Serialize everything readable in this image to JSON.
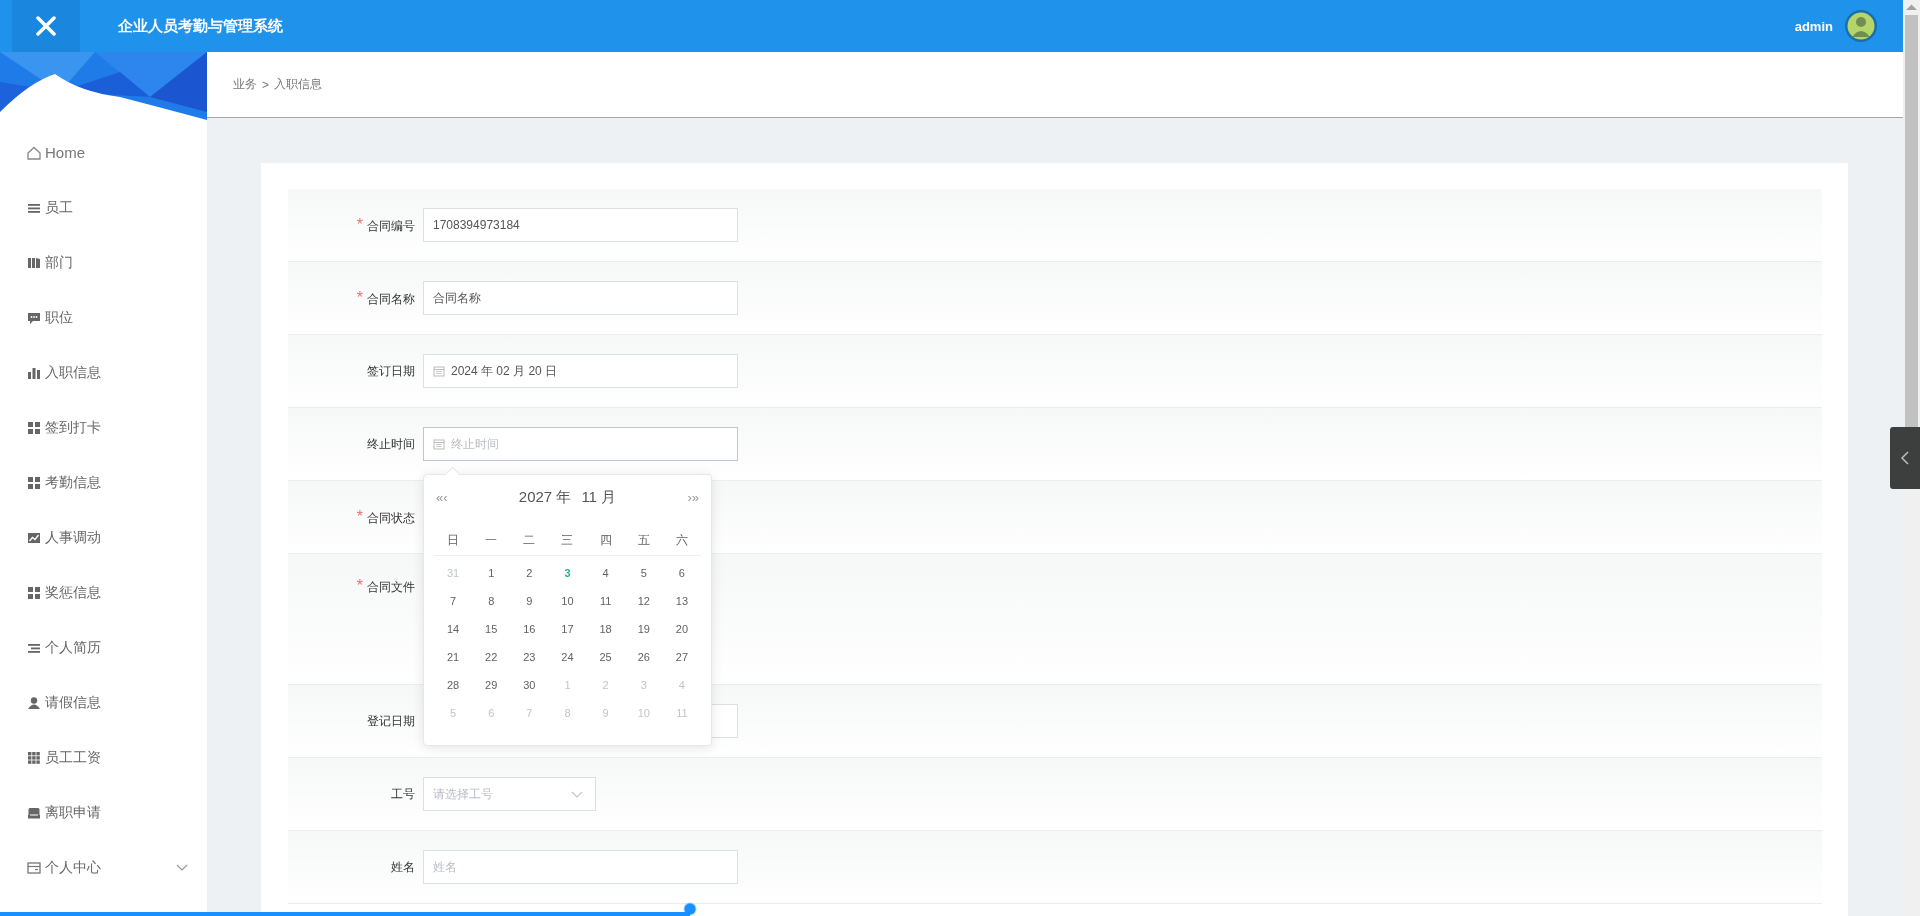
{
  "header": {
    "title": "企业人员考勤与管理系统",
    "user": "admin"
  },
  "sidebar": {
    "items": [
      {
        "label": "Home"
      },
      {
        "label": "员工"
      },
      {
        "label": "部门"
      },
      {
        "label": "职位"
      },
      {
        "label": "入职信息"
      },
      {
        "label": "签到打卡"
      },
      {
        "label": "考勤信息"
      },
      {
        "label": "人事调动"
      },
      {
        "label": "奖惩信息"
      },
      {
        "label": "个人简历"
      },
      {
        "label": "请假信息"
      },
      {
        "label": "员工工资"
      },
      {
        "label": "离职申请"
      }
    ],
    "group": {
      "label": "个人中心",
      "expanded": false
    }
  },
  "breadcrumb": {
    "items": [
      "业务",
      "入职信息"
    ],
    "separator": ">"
  },
  "form": {
    "required_mark": "*",
    "rows": [
      {
        "label": "合同编号",
        "required": true,
        "kind": "text",
        "value": "1708394973184"
      },
      {
        "label": "合同名称",
        "required": true,
        "kind": "text",
        "value": "合同名称"
      },
      {
        "label": "签订日期",
        "required": false,
        "kind": "date",
        "value": "2024 年 02 月 20 日"
      },
      {
        "label": "终止时间",
        "required": false,
        "kind": "date",
        "placeholder": "终止时间",
        "open": true
      },
      {
        "label": "合同状态",
        "required": true,
        "kind": "covered"
      },
      {
        "label": "合同文件",
        "required": true,
        "kind": "file"
      },
      {
        "label": "登记日期",
        "required": false,
        "kind": "text"
      },
      {
        "label": "工号",
        "required": false,
        "kind": "select",
        "placeholder": "请选择工号"
      },
      {
        "label": "姓名",
        "required": false,
        "kind": "text",
        "placeholder": "姓名"
      }
    ]
  },
  "calendar": {
    "prev": "«‹",
    "next": "›»",
    "year": "2027 年",
    "month": "11 月",
    "weekdays": [
      "日",
      "一",
      "二",
      "三",
      "四",
      "五",
      "六"
    ],
    "days": [
      {
        "label": "31",
        "kind": "other"
      },
      {
        "label": "1",
        "kind": "day"
      },
      {
        "label": "2",
        "kind": "day"
      },
      {
        "label": "3",
        "kind": "today"
      },
      {
        "label": "4",
        "kind": "day"
      },
      {
        "label": "5",
        "kind": "day"
      },
      {
        "label": "6",
        "kind": "day"
      },
      {
        "label": "7",
        "kind": "day"
      },
      {
        "label": "8",
        "kind": "day"
      },
      {
        "label": "9",
        "kind": "day"
      },
      {
        "label": "10",
        "kind": "day"
      },
      {
        "label": "11",
        "kind": "day"
      },
      {
        "label": "12",
        "kind": "day"
      },
      {
        "label": "13",
        "kind": "day"
      },
      {
        "label": "14",
        "kind": "day"
      },
      {
        "label": "15",
        "kind": "day"
      },
      {
        "label": "16",
        "kind": "day"
      },
      {
        "label": "17",
        "kind": "day"
      },
      {
        "label": "18",
        "kind": "day"
      },
      {
        "label": "19",
        "kind": "day"
      },
      {
        "label": "20",
        "kind": "day"
      },
      {
        "label": "21",
        "kind": "day"
      },
      {
        "label": "22",
        "kind": "day"
      },
      {
        "label": "23",
        "kind": "day"
      },
      {
        "label": "24",
        "kind": "day"
      },
      {
        "label": "25",
        "kind": "day"
      },
      {
        "label": "26",
        "kind": "day"
      },
      {
        "label": "27",
        "kind": "day"
      },
      {
        "label": "28",
        "kind": "day"
      },
      {
        "label": "29",
        "kind": "day"
      },
      {
        "label": "30",
        "kind": "day"
      },
      {
        "label": "1",
        "kind": "other"
      },
      {
        "label": "2",
        "kind": "other"
      },
      {
        "label": "3",
        "kind": "other"
      },
      {
        "label": "4",
        "kind": "other"
      },
      {
        "label": "5",
        "kind": "other"
      },
      {
        "label": "6",
        "kind": "other"
      },
      {
        "label": "7",
        "kind": "other"
      },
      {
        "label": "8",
        "kind": "other"
      },
      {
        "label": "9",
        "kind": "other"
      },
      {
        "label": "10",
        "kind": "other"
      },
      {
        "label": "11",
        "kind": "other"
      }
    ]
  },
  "progress": {
    "level": 0.363
  }
}
